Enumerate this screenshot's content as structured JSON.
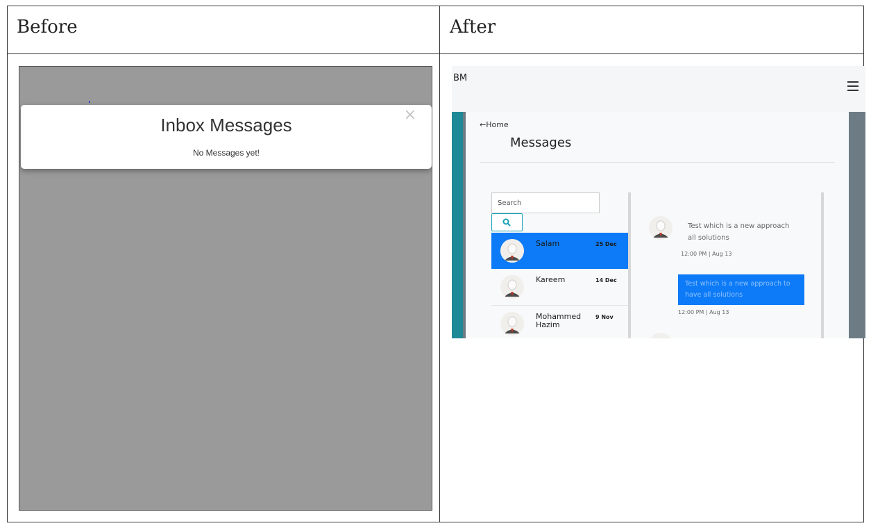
{
  "headers": {
    "before": "Before",
    "after": "After"
  },
  "before": {
    "modal": {
      "title": "Inbox Messages",
      "body": "No Messages yet!",
      "close": "×"
    }
  },
  "after": {
    "brand": "BM",
    "home_link": "←Home",
    "page_title": "Messages",
    "search": {
      "placeholder": "Search"
    },
    "chats": [
      {
        "name": "Salam",
        "date": "25 Dec",
        "active": true
      },
      {
        "name": "Kareem",
        "date": "14 Dec",
        "active": false
      },
      {
        "name": "Mohammed Hazim",
        "date": "9 Nov",
        "active": false
      }
    ],
    "conversation": {
      "incoming": {
        "text": "Test which is a new approach all solutions",
        "time": "12:00 PM | Aug 13"
      },
      "outgoing": {
        "text": "Test which is a new approach to have all solutions",
        "time": "12:00 PM | Aug 13"
      }
    },
    "colors": {
      "accent": "#0d7bf7",
      "teal": "#1e8a97",
      "sidebar": "#6d7b85"
    }
  }
}
